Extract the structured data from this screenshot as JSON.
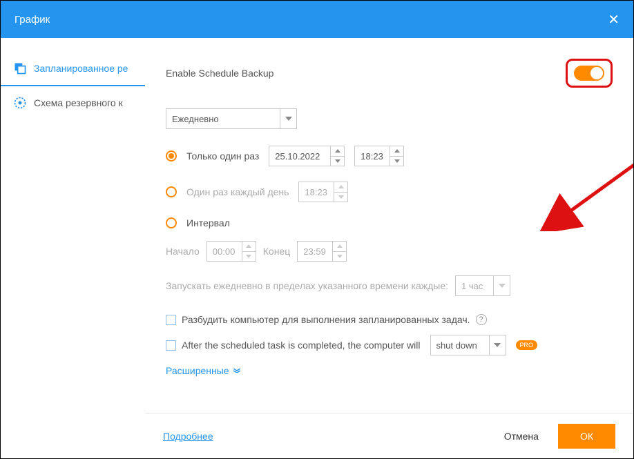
{
  "title": "График",
  "sidebar": {
    "items": [
      {
        "label": "Запланированное ре"
      },
      {
        "label": "Схема резервного к"
      }
    ]
  },
  "main": {
    "enable_label": "Enable Schedule Backup",
    "frequency": "Ежедневно",
    "opt_once": "Только один раз",
    "once_date": "25.10.2022",
    "once_time": "18:23",
    "opt_daily": "Один раз каждый день",
    "daily_time": "18:23",
    "opt_interval": "Интервал",
    "interval_start_label": "Начало",
    "interval_start": "00:00",
    "interval_end_label": "Конец",
    "interval_end": "23:59",
    "interval_every_label": "Запускать ежедневно в пределах указанного времени каждые:",
    "interval_every": "1 час",
    "chk_wake": "Разбудить компьютер для выполнения запланированных задач.",
    "chk_after": "After the scheduled task is completed, the computer will",
    "after_action": "shut down",
    "pro_badge": "PRO",
    "advanced": "Расширенные"
  },
  "footer": {
    "more": "Подробнее",
    "cancel": "Отмена",
    "ok": "ОК"
  }
}
